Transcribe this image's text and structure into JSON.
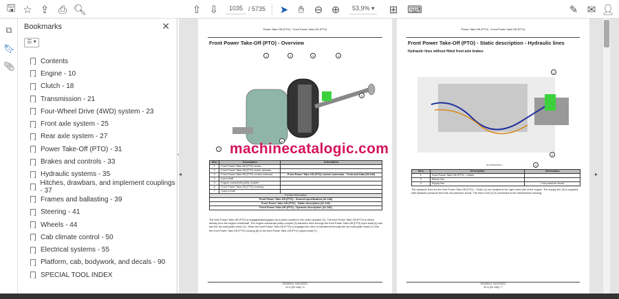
{
  "toolbar": {
    "page_current": "1035",
    "page_total": "/ 5735",
    "zoom": "53,9%"
  },
  "icons": {
    "save": "save-icon",
    "bookmark": "star-icon",
    "upload": "cloud-upload-icon",
    "print": "print-icon",
    "search": "search-icon",
    "prev": "arrow-up-circle-icon",
    "next": "arrow-down-circle-icon",
    "select": "cursor-icon",
    "hand": "hand-icon",
    "zoom_out": "minus-circle-icon",
    "zoom_in": "plus-circle-icon"
  },
  "panel": {
    "title": "Bookmarks",
    "close": "✕",
    "options": "☰ ▾",
    "items": [
      "Contents",
      "Engine - 10",
      "Clutch - 18",
      "Transmission - 21",
      "Four-Wheel Drive (4WD) system - 23",
      "Front axle system - 25",
      "Rear axle system - 27",
      "Power Take-Off (PTO) - 31",
      "Brakes and controls - 33",
      "Hydraulic systems - 35",
      "Hitches, drawbars, and implement couplings - 37",
      "Frames and ballasting - 39",
      "Steering - 41",
      "Wheels - 44",
      "Cab climate control - 50",
      "Electrical systems - 55",
      "Platform, cab, bodywork, and decals - 90",
      "SPECIAL TOOL INDEX"
    ]
  },
  "watermark": "machinecatalogic.com",
  "left_page": {
    "header": "Power Take-Off (PTO) - Front Power Take-Off (PTO)",
    "title": "Front Power Take-Off (PTO) - Overview",
    "callouts": [
      "1",
      "2",
      "3",
      "4",
      "5",
      "6",
      "7"
    ],
    "table_headers": [
      "Item",
      "Description",
      "Information"
    ],
    "rows": [
      [
        "1",
        "Front Power Take-Off (PTO) clutch",
        ""
      ],
      [
        "2",
        "Front Power Take-Off (PTO) clutch actuator",
        ""
      ],
      [
        "3",
        "Front Power Take-Off (PTO) control solenoid",
        "Front Power Take-Off (PTO) control solenoids - Technical Data (55.049)"
      ],
      [
        "4",
        "Input shaft",
        ""
      ],
      [
        "5",
        "Engine crankshaft pulley coupler",
        ""
      ],
      [
        "6",
        "Front Power Take-Off (PTO) housing",
        ""
      ],
      [
        "7",
        "Output shaft",
        ""
      ]
    ],
    "further": "Further information",
    "links": [
      "Front Power Take-Off (PTO) - General specification (31.146)",
      "Front Power Take-Off (PTO) - Static description (31.146)",
      "Front Power Take-Off (PTO) - Dynamic description (31.146)"
    ],
    "paragraph": "The front Power Take-Off (PTO) is engaged/disengaged via a piston located in the clutch actuator (2). The front Power Take-Off (PTO) is driven directly from the engine crankshaft. The engine crankshaft pulley coupler (5) transfers drive through the front Power Take-Off (PTO) input shaft (4) and into the dry multi-plate clutch (1). When the front Power Take-Off (PTO) is engaged the drive is transferred through the dry multi-plate clutch (1) into the front Power Take-Off (PTO) housing (6) to the front Power Take-Off (PTO) output shaft (7).",
    "footer1": "92165914 15/12/2022",
    "footer2": "31.5 [31.146] / 6"
  },
  "right_page": {
    "header": "Power Take-Off (PTO) - Front Power Take-Off (PTO)",
    "title": "Front Power Take-Off (PTO) - Static description - Hydraulic lines",
    "subtitle": "Hydraulic lines without fitted front axle brakes",
    "callouts": [
      "1",
      "2",
      "3"
    ],
    "figure_caption": "ILLUSTRATION    1",
    "table_headers": [
      "Item",
      "Description",
      "Information"
    ],
    "rows": [
      [
        "1",
        "Front Power Take-Off (PTO) - Clutch",
        ""
      ],
      [
        "2",
        "Return line",
        ""
      ],
      [
        "3",
        "Supply line",
        "Low pressure circuit"
      ]
    ],
    "paragraph": "The hydraulic lines for the front Power Take-Off (PTO) - Clutch (1) are located at the right-hand side of the engine. The supply line (3) is supplied with hydraulic pressure from the low pressure circuit. The return line (2) is connected to the transmission housing.",
    "footer1": "92165914 15/12/2022",
    "footer2": "31.5 [31.146] / 7"
  }
}
